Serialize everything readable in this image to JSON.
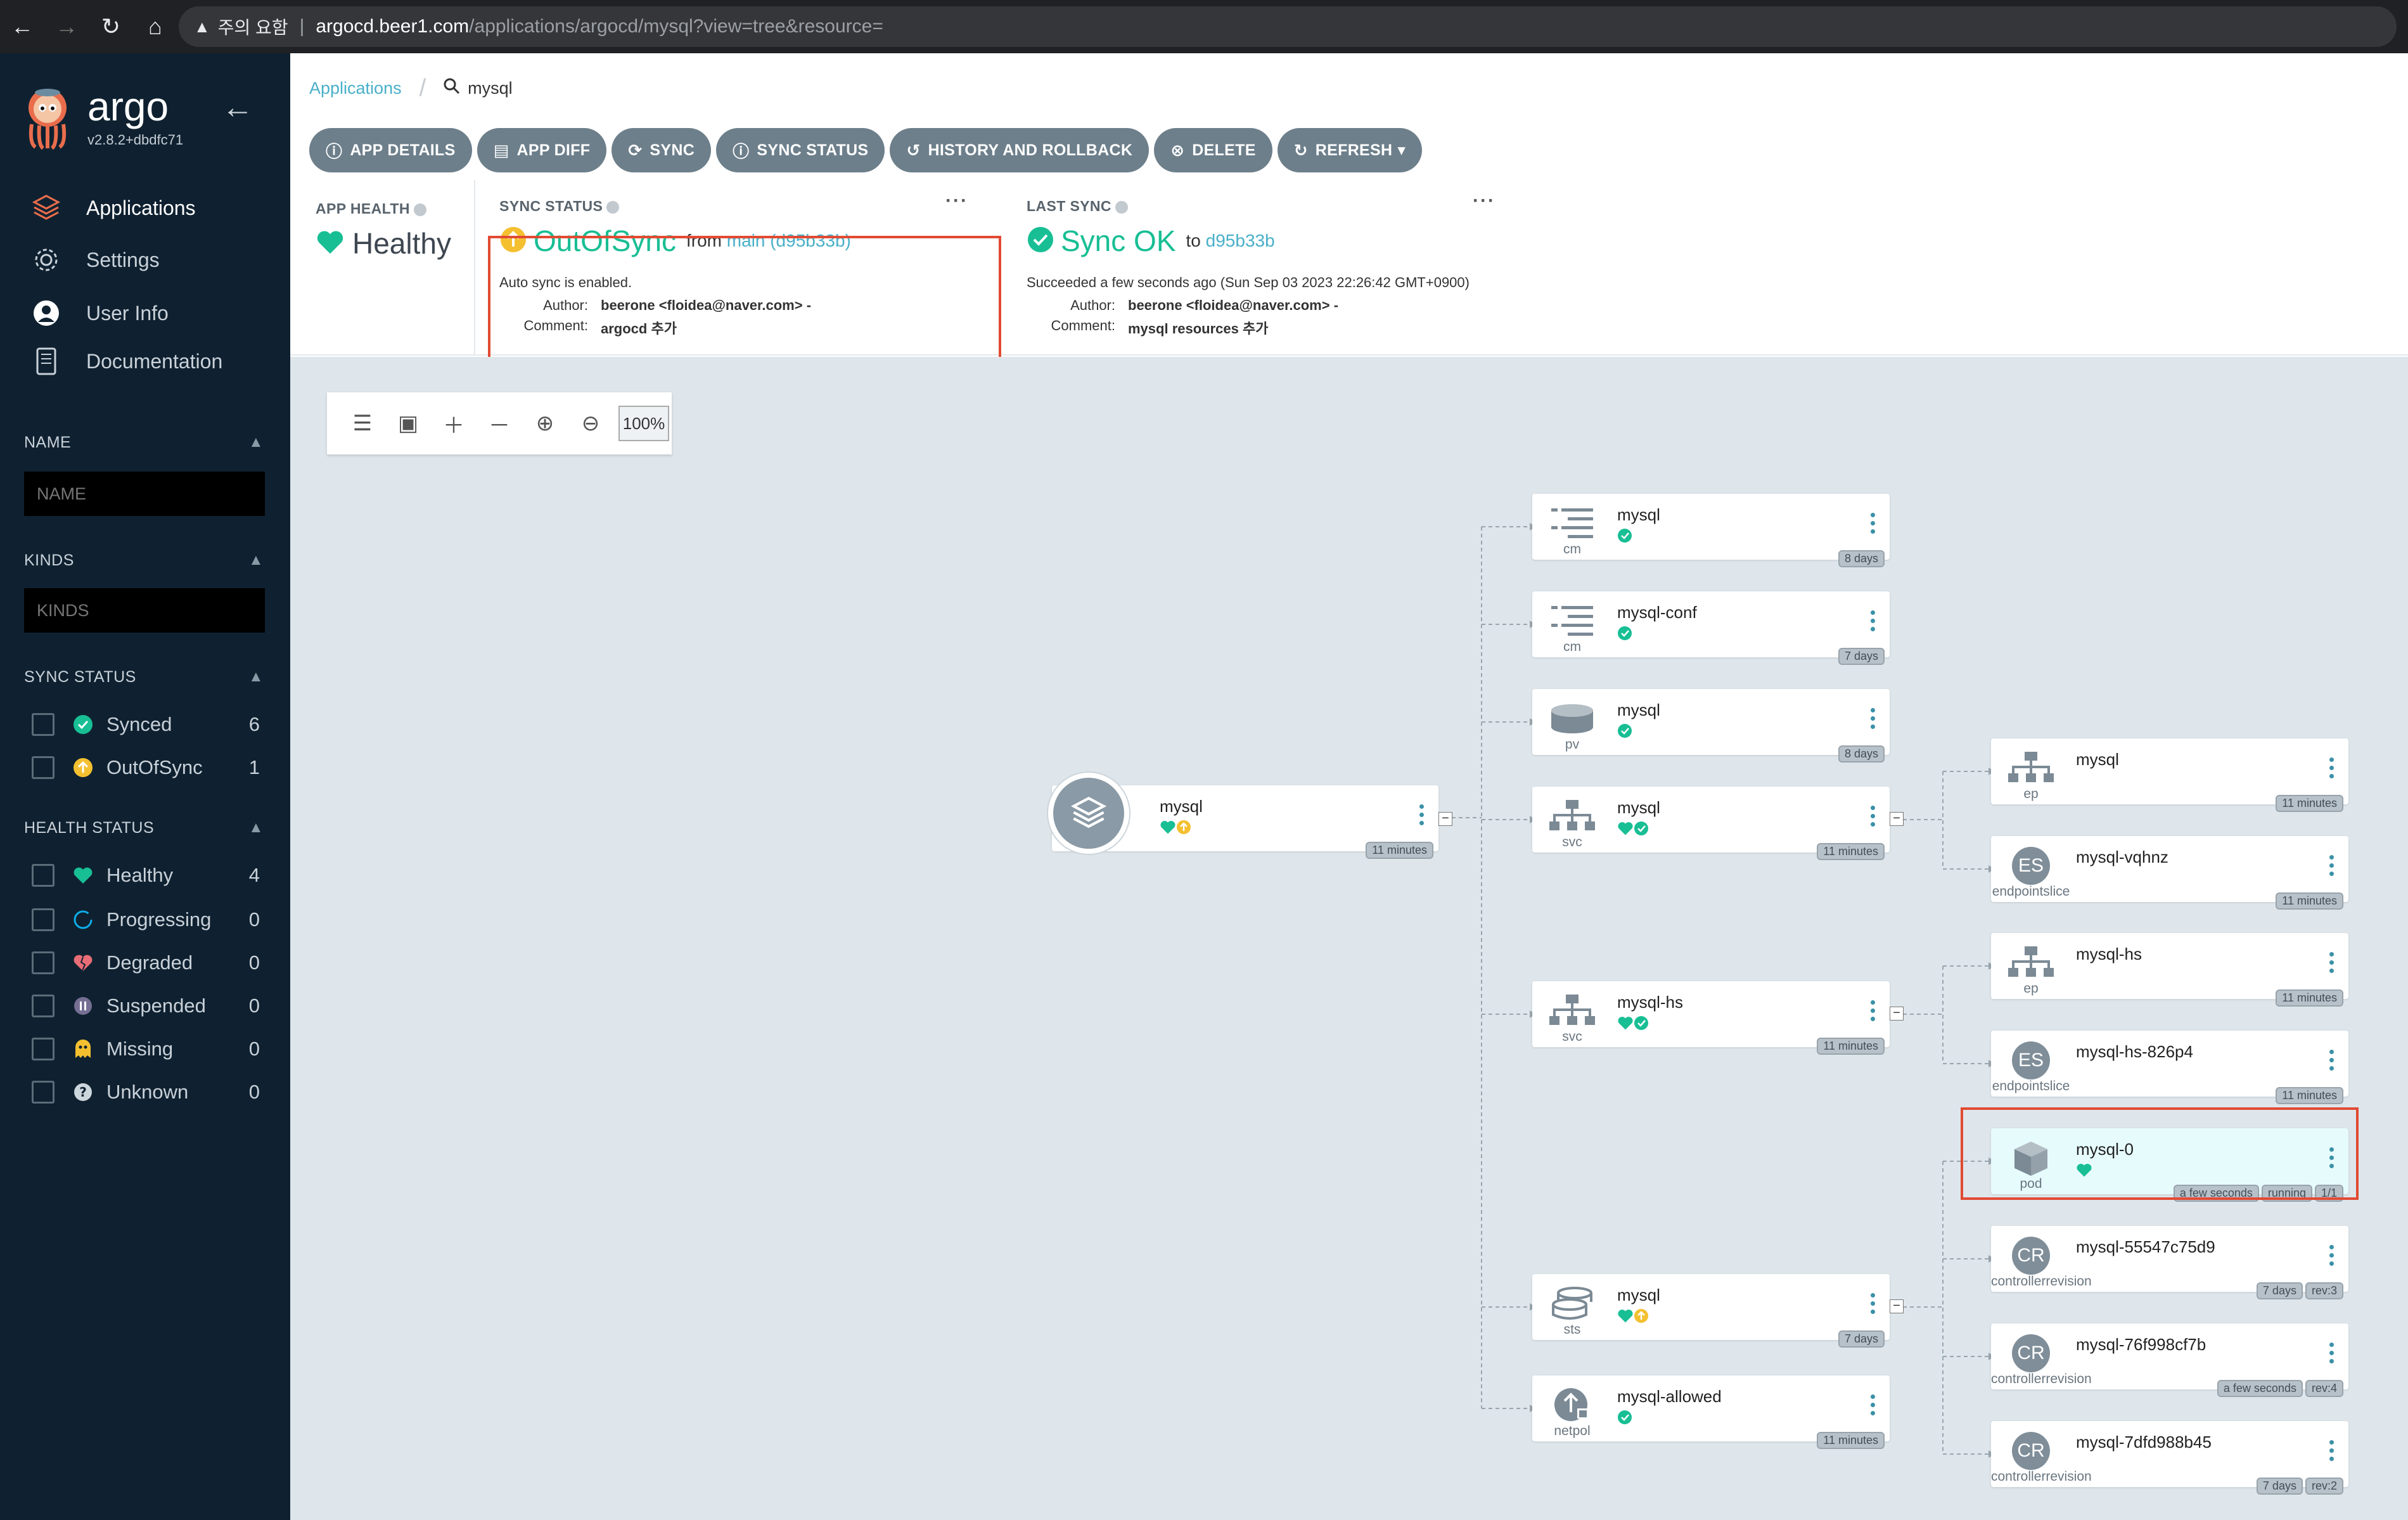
{
  "browser": {
    "warning": "주의 요함",
    "host": "argocd.beer1.com",
    "path": "/applications/argocd/mysql?view=tree&resource="
  },
  "sidebar": {
    "logo_word": "argo",
    "version": "v2.8.2+dbdfc71",
    "nav": [
      {
        "label": "Applications",
        "icon": "layers-icon"
      },
      {
        "label": "Settings",
        "icon": "gear-icon"
      },
      {
        "label": "User Info",
        "icon": "user-icon"
      },
      {
        "label": "Documentation",
        "icon": "book-icon"
      }
    ],
    "name_filter": {
      "label": "NAME",
      "placeholder": "NAME"
    },
    "kinds_filter": {
      "label": "KINDS",
      "placeholder": "KINDS"
    },
    "sync_status": {
      "label": "SYNC STATUS",
      "items": [
        {
          "label": "Synced",
          "count": "6"
        },
        {
          "label": "OutOfSync",
          "count": "1"
        }
      ]
    },
    "health_status": {
      "label": "HEALTH STATUS",
      "items": [
        {
          "label": "Healthy",
          "count": "4"
        },
        {
          "label": "Progressing",
          "count": "0"
        },
        {
          "label": "Degraded",
          "count": "0"
        },
        {
          "label": "Suspended",
          "count": "0"
        },
        {
          "label": "Missing",
          "count": "0"
        },
        {
          "label": "Unknown",
          "count": "0"
        }
      ]
    }
  },
  "breadcrumb": {
    "root": "Applications",
    "current": "mysql"
  },
  "toolbar": {
    "app_details": "APP DETAILS",
    "app_diff": "APP DIFF",
    "sync": "SYNC",
    "sync_status": "SYNC STATUS",
    "history": "HISTORY AND ROLLBACK",
    "delete": "DELETE",
    "refresh": "REFRESH"
  },
  "app_health": {
    "title": "APP HEALTH",
    "value": "Healthy"
  },
  "sync_status_panel": {
    "title": "SYNC STATUS",
    "value": "OutOfSync",
    "from_word": "from",
    "from_ref": "main (d95b33b)",
    "auto": "Auto sync is enabled.",
    "author_label": "Author:",
    "author": "beerone <floidea@naver.com> -",
    "comment_label": "Comment:",
    "comment": "argocd 추가"
  },
  "last_sync_panel": {
    "title": "LAST SYNC",
    "value": "Sync OK",
    "to_word": "to",
    "to_ref": "d95b33b",
    "succeeded": "Succeeded a few seconds ago (Sun Sep 03 2023 22:26:42 GMT+0900)",
    "author_label": "Author:",
    "author": "beerone <floidea@naver.com> -",
    "comment_label": "Comment:",
    "comment": "mysql resources 추가"
  },
  "zoom": {
    "level": "100%"
  },
  "colors": {
    "healthy": "#18be94",
    "outofsync": "#f4c030",
    "accent": "#49b0c9",
    "sidebar": "#0f2130",
    "highlight": "#e24a33"
  },
  "tree": {
    "app": {
      "name": "mysql",
      "tags": [
        "11 minutes"
      ]
    },
    "resources": [
      {
        "name": "mysql",
        "kind": "cm",
        "tags": [
          "8 days"
        ]
      },
      {
        "name": "mysql-conf",
        "kind": "cm",
        "tags": [
          "7 days"
        ]
      },
      {
        "name": "mysql",
        "kind": "pv",
        "tags": [
          "8 days"
        ]
      },
      {
        "name": "mysql",
        "kind": "svc",
        "tags": [
          "11 minutes"
        ]
      },
      {
        "name": "mysql-hs",
        "kind": "svc",
        "tags": [
          "11 minutes"
        ]
      },
      {
        "name": "mysql",
        "kind": "sts",
        "tags": [
          "7 days"
        ]
      },
      {
        "name": "mysql-allowed",
        "kind": "netpol",
        "tags": [
          "11 minutes"
        ]
      }
    ],
    "children": [
      {
        "name": "mysql",
        "kind": "ep",
        "tags": [
          "11 minutes"
        ]
      },
      {
        "name": "mysql-vqhnz",
        "kind": "endpointslice",
        "letters": "ES",
        "tags": [
          "11 minutes"
        ]
      },
      {
        "name": "mysql-hs",
        "kind": "ep",
        "tags": [
          "11 minutes"
        ]
      },
      {
        "name": "mysql-hs-826p4",
        "kind": "endpointslice",
        "letters": "ES",
        "tags": [
          "11 minutes"
        ]
      },
      {
        "name": "mysql-0",
        "kind": "pod",
        "tags": [
          "a few seconds",
          "running",
          "1/1"
        ]
      },
      {
        "name": "mysql-55547c75d9",
        "kind": "controllerrevision",
        "letters": "CR",
        "tags": [
          "7 days",
          "rev:3"
        ]
      },
      {
        "name": "mysql-76f998cf7b",
        "kind": "controllerrevision",
        "letters": "CR",
        "tags": [
          "a few seconds",
          "rev:4"
        ]
      },
      {
        "name": "mysql-7dfd988b45",
        "kind": "controllerrevision",
        "letters": "CR",
        "tags": [
          "7 days",
          "rev:2"
        ]
      }
    ]
  }
}
